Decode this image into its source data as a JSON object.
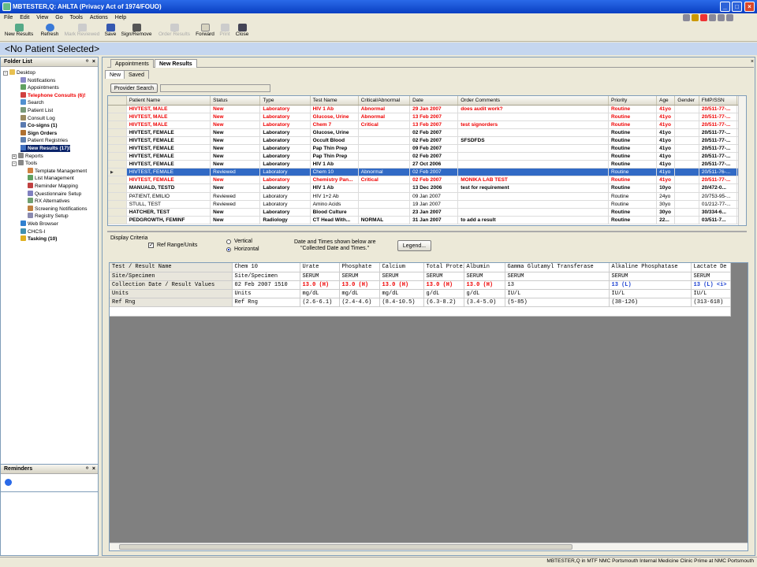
{
  "window": {
    "title": "MBTESTER,Q: AHLTA  (Privacy Act of 1974/FOUO)"
  },
  "menu": [
    "File",
    "Edit",
    "View",
    "Go",
    "Tools",
    "Actions",
    "Help"
  ],
  "toolbar": {
    "buttons": [
      {
        "label": "New Results",
        "icon": "new-results-icon",
        "enabled": true
      },
      {
        "label": "Refresh",
        "icon": "refresh-icon",
        "enabled": true
      },
      {
        "label": "Mark Reviewed",
        "icon": "mark-reviewed-icon",
        "enabled": false
      },
      {
        "label": "Save",
        "icon": "save-icon",
        "enabled": true
      },
      {
        "label": "Sign/Remove",
        "icon": "sign-remove-icon",
        "enabled": true
      },
      {
        "label": "Order Results",
        "icon": "order-results-icon",
        "enabled": false
      },
      {
        "label": "Forward",
        "icon": "forward-icon",
        "enabled": true
      },
      {
        "label": "Print",
        "icon": "print-icon",
        "enabled": false
      },
      {
        "label": "Close",
        "icon": "close-icon",
        "enabled": true
      }
    ]
  },
  "patient": {
    "banner": "<No Patient Selected>"
  },
  "folder_list": {
    "title": "Folder List",
    "items": [
      {
        "label": "Desktop",
        "style": "normal",
        "icon": "folder-icon",
        "level": 0
      },
      {
        "label": "Notifications",
        "style": "normal",
        "icon": "notifications-icon",
        "level": 1
      },
      {
        "label": "Appointments",
        "style": "normal",
        "icon": "appointments-icon",
        "level": 1
      },
      {
        "label": "Telephone Consults (6)!",
        "style": "red",
        "icon": "telephone-icon",
        "level": 1
      },
      {
        "label": "Search",
        "style": "normal",
        "icon": "search-icon",
        "level": 1
      },
      {
        "label": "Patient List",
        "style": "normal",
        "icon": "patient-list-icon",
        "level": 1
      },
      {
        "label": "Consult Log",
        "style": "normal",
        "icon": "consult-log-icon",
        "level": 1
      },
      {
        "label": "Co-signs (1)",
        "style": "bold",
        "icon": "cosign-icon",
        "level": 1
      },
      {
        "label": "Sign Orders",
        "style": "bold",
        "icon": "sign-orders-icon",
        "level": 1
      },
      {
        "label": "Patient Registries",
        "style": "normal",
        "icon": "registries-icon",
        "level": 1
      },
      {
        "label": "New Results (17)!",
        "style": "selected",
        "icon": "new-results-icon",
        "level": 1
      },
      {
        "label": "Reports",
        "style": "normal",
        "icon": "reports-icon",
        "level": 0
      },
      {
        "label": "Tools",
        "style": "normal",
        "icon": "tools-icon",
        "level": 0
      },
      {
        "label": "Template Management",
        "style": "normal",
        "icon": "template-icon",
        "level": 2
      },
      {
        "label": "List Management",
        "style": "normal",
        "icon": "list-icon",
        "level": 2
      },
      {
        "label": "Reminder Mapping",
        "style": "normal",
        "icon": "reminder-icon",
        "level": 2
      },
      {
        "label": "Questionnaire Setup",
        "style": "normal",
        "icon": "questionnaire-icon",
        "level": 2
      },
      {
        "label": "RX Alternatives",
        "style": "normal",
        "icon": "rx-icon",
        "level": 2
      },
      {
        "label": "Screening Notifications",
        "style": "normal",
        "icon": "screening-icon",
        "level": 2
      },
      {
        "label": "Registry Setup",
        "style": "normal",
        "icon": "registry-icon",
        "level": 2
      },
      {
        "label": "Web Browser",
        "style": "normal",
        "icon": "globe-icon",
        "level": 1
      },
      {
        "label": "CHCS-I",
        "style": "normal",
        "icon": "chcs-icon",
        "level": 1
      },
      {
        "label": "Tasking (10)",
        "style": "bold",
        "icon": "warning-icon",
        "level": 1
      }
    ]
  },
  "reminders": {
    "title": "Reminders"
  },
  "tabs": {
    "main": [
      "Appointments",
      "New Results"
    ],
    "sub": [
      "New",
      "Saved"
    ]
  },
  "provider_search": {
    "label": "Provider Search",
    "value": ""
  },
  "grid": {
    "columns": [
      "Patient Name",
      "Status",
      "Type",
      "Test Name",
      "Critical/Abnormal",
      "Date",
      "Order Comments",
      "Priority",
      "Age",
      "Gender",
      "FMP/SSN"
    ],
    "rows": [
      {
        "style": "red",
        "cells": [
          "HIVTEST, MALE",
          "New",
          "Laboratory",
          "HIV 1 Ab",
          "Abnormal",
          "29 Jan 2007",
          "does audit work?",
          "Routine",
          "41yo",
          "",
          "20/511-77-..."
        ]
      },
      {
        "style": "red",
        "cells": [
          "HIVTEST, MALE",
          "New",
          "Laboratory",
          "Glucose, Urine",
          "Abnormal",
          "13 Feb 2007",
          "",
          "Routine",
          "41yo",
          "",
          "20/511-77-..."
        ]
      },
      {
        "style": "red",
        "cells": [
          "HIVTEST, MALE",
          "New",
          "Laboratory",
          "Chem 7",
          "Critical",
          "13 Feb 2007",
          "test signorders",
          "Routine",
          "41yo",
          "",
          "20/511-77-..."
        ]
      },
      {
        "style": "bold",
        "cells": [
          "HIVTEST, FEMALE",
          "New",
          "Laboratory",
          "Glucose, Urine",
          "",
          "02 Feb 2007",
          "",
          "Routine",
          "41yo",
          "",
          "20/511-77-..."
        ]
      },
      {
        "style": "bold",
        "cells": [
          "HIVTEST, FEMALE",
          "New",
          "Laboratory",
          "Occult Blood",
          "",
          "02 Feb 2007",
          "SFSDFDS",
          "Routine",
          "41yo",
          "",
          "20/511-77-..."
        ]
      },
      {
        "style": "bold",
        "cells": [
          "HIVTEST, FEMALE",
          "New",
          "Laboratory",
          "Pap Thin Prep",
          "",
          "09 Feb 2007",
          "",
          "Routine",
          "41yo",
          "",
          "20/511-77-..."
        ]
      },
      {
        "style": "bold",
        "cells": [
          "HIVTEST, FEMALE",
          "New",
          "Laboratory",
          "Pap Thin Prep",
          "",
          "02 Feb 2007",
          "",
          "Routine",
          "41yo",
          "",
          "20/511-77-..."
        ]
      },
      {
        "style": "bold",
        "cells": [
          "HIVTEST, FEMALE",
          "New",
          "Laboratory",
          "HIV 1 Ab",
          "",
          "27 Oct 2006",
          "",
          "Routine",
          "41yo",
          "",
          "20/511-77-..."
        ]
      },
      {
        "style": "sel",
        "cells": [
          "HIVTEST, FEMALE",
          "Reviewed",
          "Laboratory",
          "Chem 10",
          "Abnormal",
          "02 Feb 2007",
          "",
          "Routine",
          "41yo",
          "",
          "20/511-76-..."
        ]
      },
      {
        "style": "red",
        "cells": [
          "HIVTEST, FEMALE",
          "New",
          "Laboratory",
          "Chemistry Pan...",
          "Critical",
          "02 Feb 2007",
          "MONIKA LAB TEST",
          "Routine",
          "41yo",
          "",
          "20/511-77-..."
        ]
      },
      {
        "style": "bold",
        "cells": [
          "MANUALD, TESTD",
          "New",
          "Laboratory",
          "HIV 1 Ab",
          "",
          "13 Dec 2006",
          "test for requirement",
          "Routine",
          "10yo",
          "",
          "20/472-0..."
        ]
      },
      {
        "style": "normal",
        "cells": [
          "PATIENT, EMILIO",
          "Reviewed",
          "Laboratory",
          "HIV 1+2 Ab",
          "",
          "09 Jan 2007",
          "",
          "Routine",
          "24yo",
          "",
          "20/753-95-..."
        ]
      },
      {
        "style": "normal",
        "cells": [
          "STULL, TEST",
          "Reviewed",
          "Laboratory",
          "Amino Acids",
          "",
          "19 Jan 2007",
          "",
          "Routine",
          "30yo",
          "",
          "01/212-77-..."
        ]
      },
      {
        "style": "bold",
        "cells": [
          "HATCHER, TEST",
          "New",
          "Laboratory",
          "Blood Culture",
          "",
          "23 Jan 2007",
          "",
          "Routine",
          "30yo",
          "",
          "30/334-6..."
        ]
      },
      {
        "style": "bold",
        "cells": [
          "PEDGROWTH, FEMINF",
          "New",
          "Radiology",
          "CT Head With...",
          "NORMAL",
          "31 Jan 2007",
          "to add a result",
          "Routine",
          "22...",
          "",
          "03/511-7..."
        ]
      }
    ]
  },
  "display_criteria": {
    "title": "Display Criteria",
    "ref_range_label": "Ref Range/Units",
    "ref_range_checked": true,
    "radio_vertical": "Vertical",
    "radio_horizontal": "Horizontal",
    "selected": "Horizontal",
    "note_line1": "Date and Times shown below are",
    "note_line2": "\"Collected Date and Times.\"",
    "legend_button": "Legend..."
  },
  "results_table": {
    "row_headers": [
      "Test / Result Name",
      "Site/Specimen",
      "Collection Date / Result Values",
      "Units",
      "Ref Rng"
    ],
    "columns": [
      {
        "cells": [
          "Chem 10",
          "Site/Specimen",
          "02 Feb 2007 1510",
          "Units",
          "Ref Rng"
        ],
        "flags": [
          "",
          "",
          "",
          "",
          ""
        ]
      },
      {
        "cells": [
          "Urate",
          "SERUM",
          "13.0 (H)",
          "mg/dL",
          "(2.6-6.1)"
        ],
        "flags": [
          "",
          "",
          "hi",
          "",
          ""
        ]
      },
      {
        "cells": [
          "Phosphate",
          "SERUM",
          "13.0 (H)",
          "mg/dL",
          "(2.4-4.6)"
        ],
        "flags": [
          "",
          "",
          "hi",
          "",
          ""
        ]
      },
      {
        "cells": [
          "Calcium",
          "SERUM",
          "13.0 (H)",
          "mg/dL",
          "(8.4-10.5)"
        ],
        "flags": [
          "",
          "",
          "hi",
          "",
          ""
        ]
      },
      {
        "cells": [
          "Total Protein",
          "SERUM",
          "13.0 (H)",
          "g/dL",
          "(6.3-8.2)"
        ],
        "flags": [
          "",
          "",
          "hi",
          "",
          ""
        ]
      },
      {
        "cells": [
          "Albumin",
          "SERUM",
          "13.0 (H)",
          "g/dL",
          "(3.4-5.0)"
        ],
        "flags": [
          "",
          "",
          "hi",
          "",
          ""
        ]
      },
      {
        "cells": [
          "Gamma Glutamyl Transferase",
          "SERUM",
          "13",
          "IU/L",
          "(5-85)"
        ],
        "flags": [
          "",
          "",
          "",
          "",
          ""
        ]
      },
      {
        "cells": [
          "Alkaline Phosphatase",
          "SERUM",
          "13 (L)",
          "IU/L",
          "(38-126)"
        ],
        "flags": [
          "",
          "",
          "lo",
          "",
          ""
        ]
      },
      {
        "cells": [
          "Lactate De",
          "SERUM",
          "13 (L) <i>",
          "IU/L",
          "(313-618)"
        ],
        "flags": [
          "",
          "",
          "lo",
          "",
          ""
        ]
      }
    ]
  },
  "statusbar": {
    "text": "MBTESTER,Q in MTF NMC Portsmouth Internal Medicine Clinic Prime at NMC Portsmouth"
  }
}
